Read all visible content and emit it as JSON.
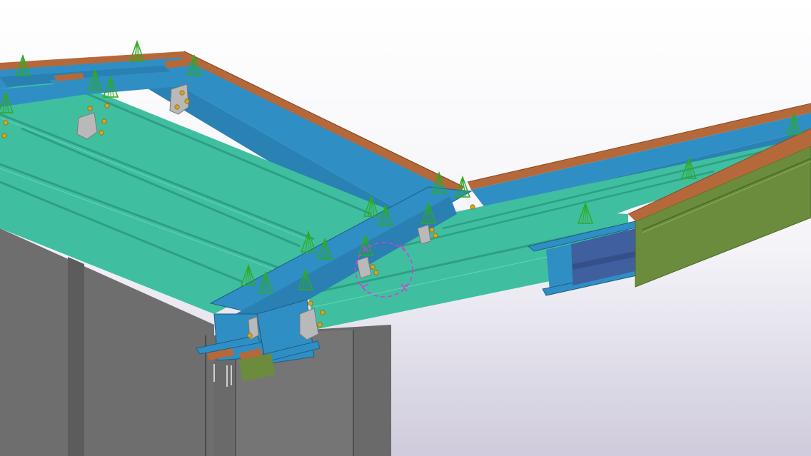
{
  "viewport": {
    "background_top": "#ffffff",
    "background_bottom": "#cfcbdc"
  },
  "colors": {
    "column_gray": "#6e6e6e",
    "column_gray_dark": "#5a5a5a",
    "column_gray_light": "#848484",
    "purlin_teal": "#3fbfa0",
    "purlin_teal_dark": "#2e9e85",
    "rafter_blue": "#2f8fc4",
    "rafter_blue_dark": "#2273a3",
    "deep_blue": "#3f5f9f",
    "edge_brown": "#b5693a",
    "edge_brown_dark": "#8a4a22",
    "fascia_green": "#6a8c3c",
    "bolt_orange": "#d9a521",
    "plate_gray": "#b9b9b9",
    "load_green": "#2faa22",
    "selection_magenta": "#d040d8"
  },
  "scene": {
    "name": "steel-roof-ridge-connection-3d-view",
    "selection_marker": "weld-selection-circle"
  }
}
